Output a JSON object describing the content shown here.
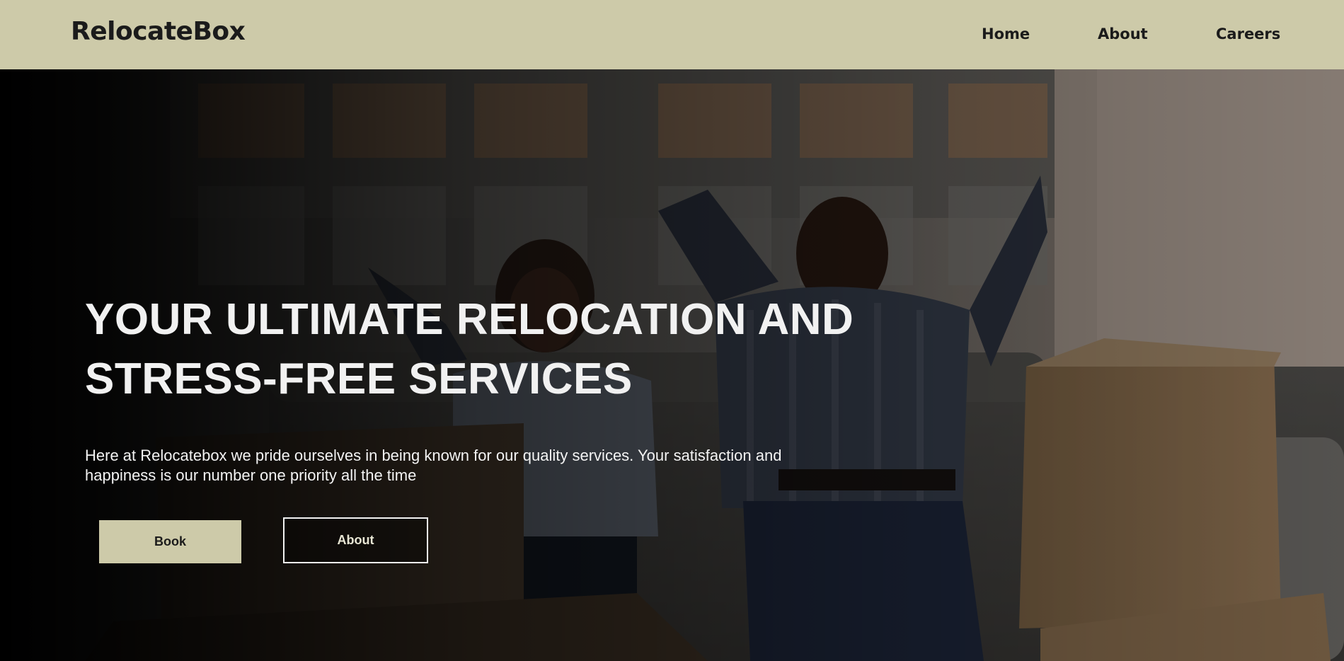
{
  "navbar": {
    "brand": "RelocateBox",
    "links": [
      {
        "label": "Home"
      },
      {
        "label": "About"
      },
      {
        "label": "Careers"
      }
    ]
  },
  "hero": {
    "title": "YOUR ULTIMATE RELOCATION AND STRESS-FREE SERVICES",
    "subtitle": "Here at Relocatebox we pride ourselves in being known for our quality services. Your satisfaction and happiness is our number one priority all the time",
    "buttons": {
      "primary_label": "Book",
      "secondary_label": "About"
    }
  },
  "colors": {
    "navbar_bg": "#cdcaa9",
    "brand_text": "#1b1b1b",
    "hero_text": "#f1f1f1"
  }
}
